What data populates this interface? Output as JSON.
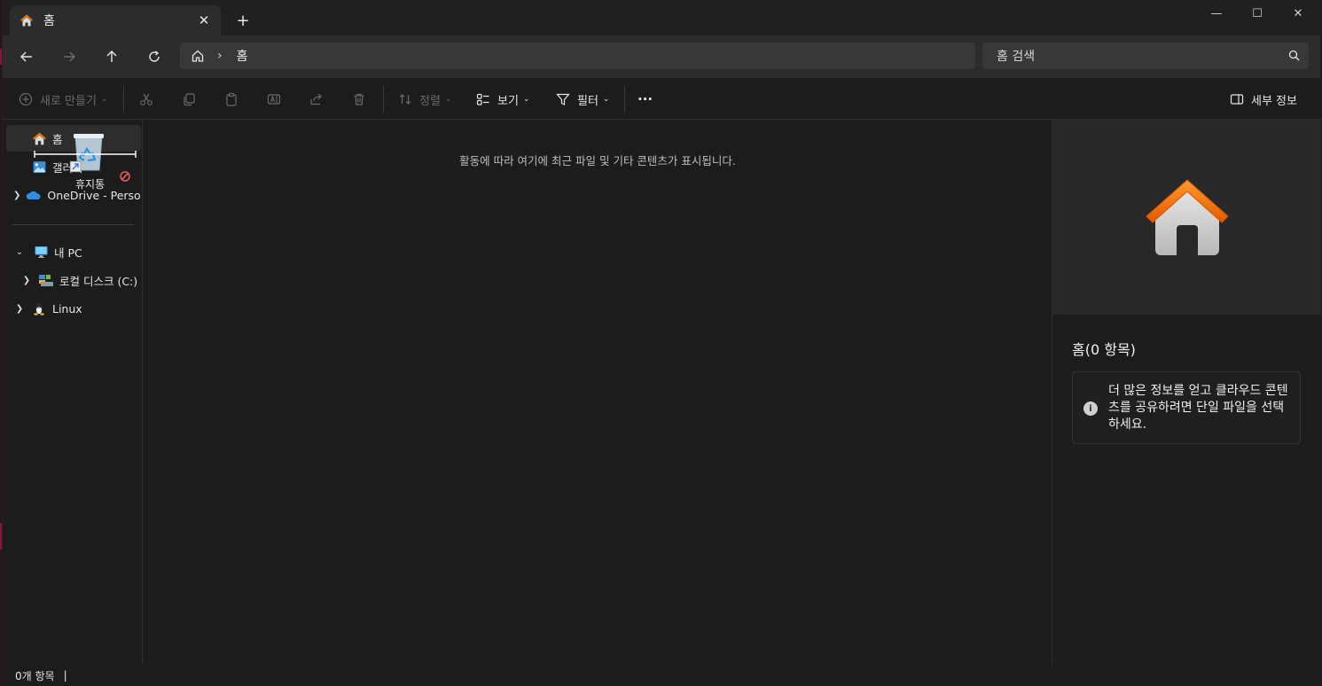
{
  "tab": {
    "title": "홈",
    "close_glyph": "✕"
  },
  "new_tab_glyph": "+",
  "window_controls": {
    "minimize": "—",
    "maximize": "☐",
    "close": "✕"
  },
  "address": {
    "crumb_separator": "›",
    "current": "홈"
  },
  "search": {
    "placeholder": "홈 검색"
  },
  "commands": {
    "new": "새로 만들기",
    "sort": "정렬",
    "view": "보기",
    "filter": "필터",
    "more": "···",
    "details": "세부 정보"
  },
  "nav": {
    "items": [
      {
        "label": "홈",
        "icon": "home-icon"
      },
      {
        "label": "갤러리",
        "icon": "gallery-icon"
      },
      {
        "label": "OneDrive - Personal",
        "icon": "onedrive-icon"
      },
      {
        "label": "내 PC",
        "icon": "pc-icon"
      },
      {
        "label": "로컬 디스크 (C:)",
        "icon": "drive-icon"
      },
      {
        "label": "Linux",
        "icon": "linux-icon"
      }
    ]
  },
  "drag_ghost": {
    "label": "휴지통"
  },
  "content": {
    "empty_message": "활동에 따라 여기에 최근 파일 및 기타 콘텐츠가 표시됩니다."
  },
  "details_pane": {
    "title": "홈(0 항목)",
    "info": "더 많은 정보를 얻고 클라우드 콘텐츠를 공유하려면 단일 파일을 선택하세요."
  },
  "status": {
    "item_count": "0개 항목",
    "caret": "|"
  },
  "colors": {
    "accent_orange": "#f07a12",
    "home_roof": "#e8610a",
    "background": "#1c1c1c"
  }
}
